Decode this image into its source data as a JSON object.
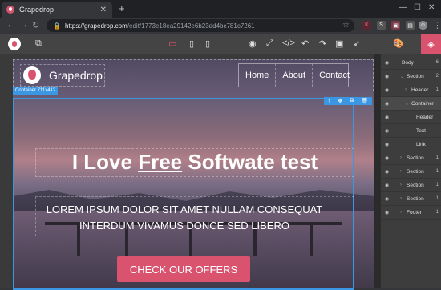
{
  "browser": {
    "tab_title": "Grapedrop",
    "url_host": "https://grapedrop.com",
    "url_path": "/edit/1773e18ea29142e6b23dd4bc781c7261"
  },
  "editor": {
    "device_icons": [
      "desktop-icon",
      "tablet-icon",
      "mobile-icon"
    ],
    "tool_icons": [
      "eye-icon",
      "fullscreen-icon",
      "code-icon",
      "undo-icon",
      "redo-icon",
      "save-icon",
      "rocket-icon"
    ]
  },
  "canvas": {
    "brand_name": "Grapedrop",
    "nav_links": [
      "Home",
      "About",
      "Contact"
    ],
    "container_badge": "Container 711x412",
    "headline_before": "I Love ",
    "headline_highlight": "Free",
    "headline_after": " Softwate test",
    "lead_line1": "LOREM IPSUM DOLOR SIT AMET NULLAM CONSEQUAT",
    "lead_line2": "INTERDUM VIVAMUS DONCE SED LIBERO",
    "cta_label": "CHECK OUR OFFERS"
  },
  "layers": [
    {
      "label": "Body",
      "count": "6",
      "indent": 0,
      "caret": false
    },
    {
      "label": "Section",
      "count": "2",
      "indent": 1,
      "caret": true
    },
    {
      "label": "Header",
      "count": "1",
      "indent": 2,
      "caret": true
    },
    {
      "label": "Container",
      "count": "",
      "indent": 2,
      "caret": true
    },
    {
      "label": "Header",
      "count": "",
      "indent": 3,
      "caret": false
    },
    {
      "label": "Text",
      "count": "",
      "indent": 3,
      "caret": false
    },
    {
      "label": "Link",
      "count": "",
      "indent": 3,
      "caret": false
    },
    {
      "label": "Section",
      "count": "1",
      "indent": 1,
      "caret": true
    },
    {
      "label": "Section",
      "count": "1",
      "indent": 1,
      "caret": true
    },
    {
      "label": "Section",
      "count": "1",
      "indent": 1,
      "caret": true
    },
    {
      "label": "Section",
      "count": "1",
      "indent": 1,
      "caret": true
    },
    {
      "label": "Footer",
      "count": "1",
      "indent": 1,
      "caret": true
    }
  ],
  "colors": {
    "accent": "#d9536f",
    "selection": "#3b97e3"
  }
}
